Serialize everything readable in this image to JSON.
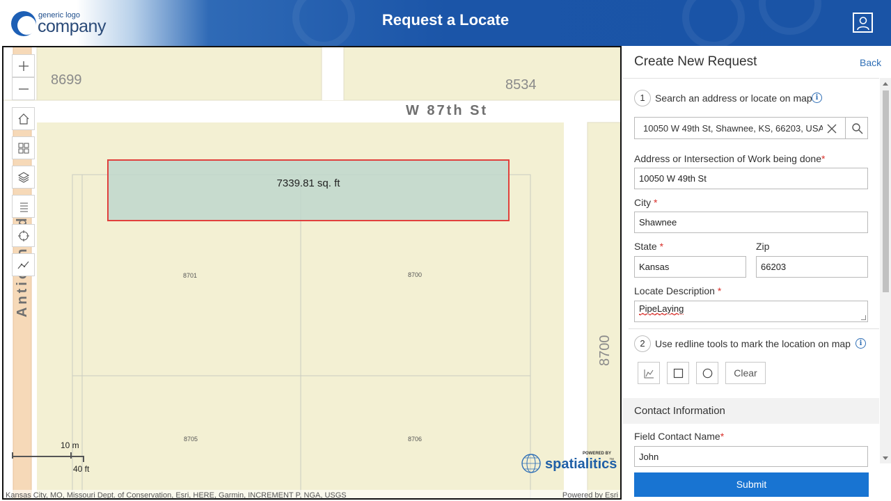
{
  "header": {
    "logo_small": "generic logo",
    "logo_big": "company",
    "title": "Request a Locate"
  },
  "map": {
    "parcel_numbers": [
      "8699",
      "8534",
      "8700"
    ],
    "street_horizontal": "W 87th St",
    "street_vertical": "Antioch Rd",
    "measurement": "7339.81 sq. ft",
    "lots": [
      "8701",
      "8700",
      "8705",
      "8706"
    ],
    "scale_metric": "10 m",
    "scale_imperial": "40 ft",
    "powered_small": "POWERED BY",
    "powered_brand": "spatialitics",
    "powered_tm": "™",
    "attribution_left": "Kansas City, MO, Missouri Dept. of Conservation, Esri, HERE, Garmin, INCREMENT P, NGA, USGS",
    "attribution_right": "Powered by Esri"
  },
  "panel": {
    "heading": "Create New Request",
    "back": "Back",
    "step1": {
      "number": "1",
      "text": "Search an address or locate on map"
    },
    "search_value": "10050 W 49th St, Shawnee, KS, 66203, USA",
    "address_label": "Address or Intersection of Work being done",
    "address_value": "10050 W 49th St",
    "city_label": "City",
    "city_value": "Shawnee",
    "state_label": "State",
    "state_value": "Kansas",
    "zip_label": "Zip",
    "zip_value": "66203",
    "desc_label": "Locate Description",
    "desc_value": "PipeLaying",
    "required_mark": "*",
    "step2": {
      "number": "2",
      "text": "Use redline tools to mark the location on map"
    },
    "clear": "Clear",
    "contact_heading": "Contact Information",
    "field_contact_label": "Field Contact Name",
    "field_contact_value": "John",
    "submit": "Submit"
  },
  "colors": {
    "header_blue": "#1b55a8",
    "submit_blue": "#1874d2",
    "link_blue": "#2f6fb6",
    "required_red": "#d9302a",
    "measure_border": "#e0403c",
    "map_land": "#f3f0d3"
  },
  "icons": {
    "user": "user-icon",
    "zoom_in": "plus-icon",
    "zoom_out": "minus-icon",
    "home": "home-icon",
    "basemap": "grid-icon",
    "layers": "layers-icon",
    "legend": "list-icon",
    "locate": "crosshair-icon",
    "measure": "polyline-icon",
    "search": "search-icon",
    "clear": "close-icon",
    "info": "info-icon"
  }
}
